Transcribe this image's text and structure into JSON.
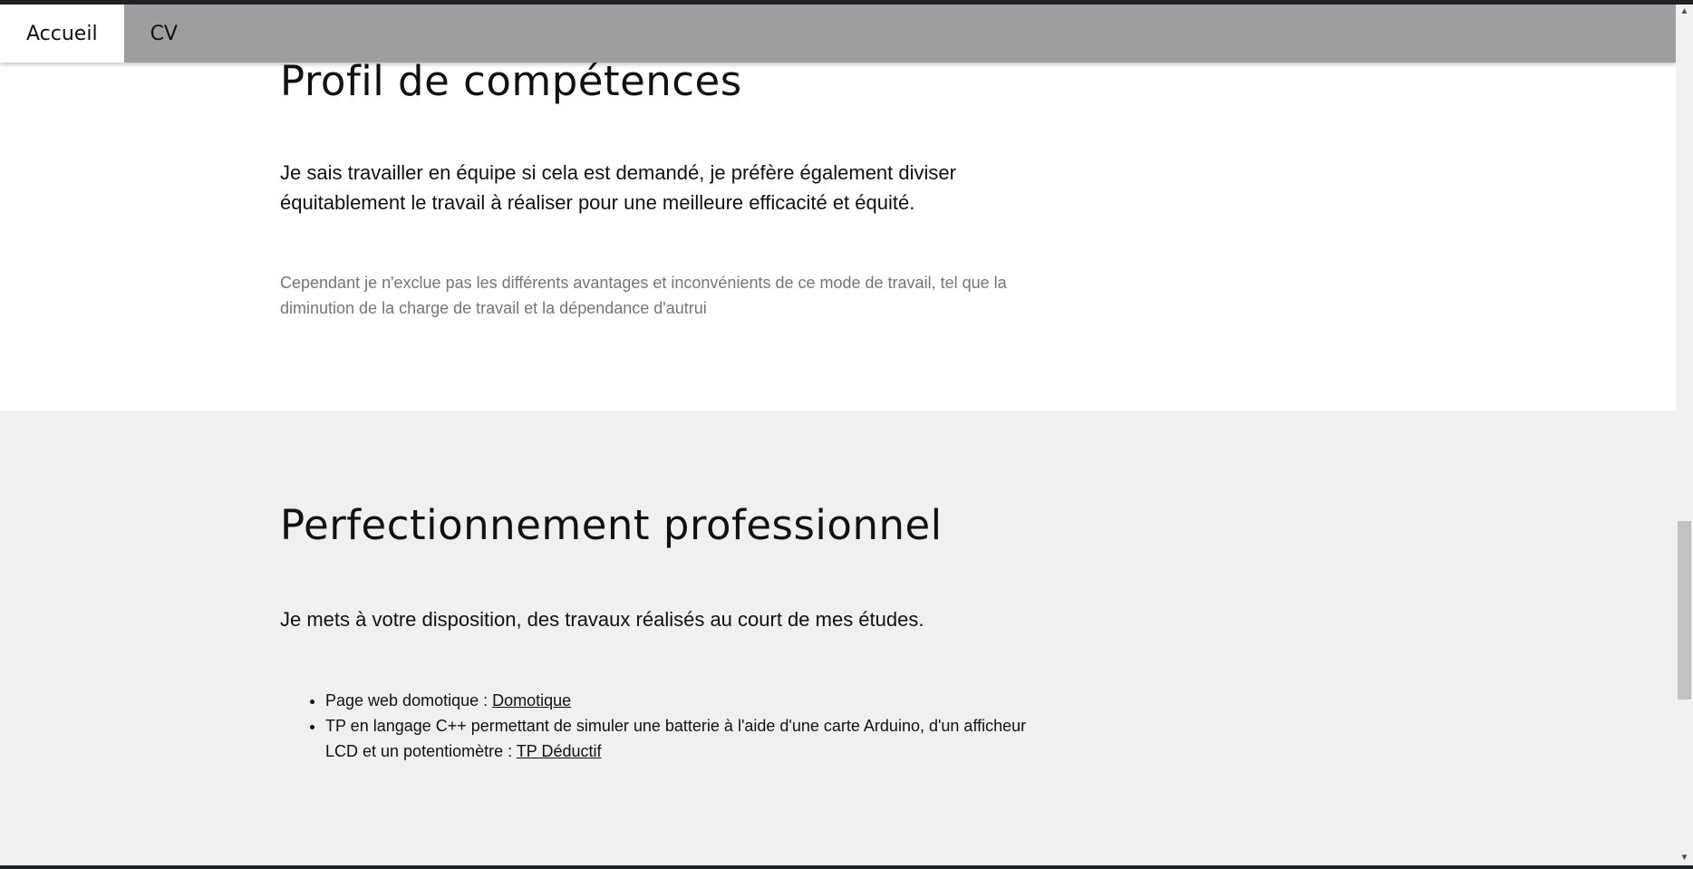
{
  "nav": {
    "items": [
      {
        "label": "Accueil",
        "active": true
      },
      {
        "label": "CV",
        "active": false
      }
    ]
  },
  "skills_section": {
    "title": "Profil de compétences",
    "lead": "Je sais travailler en équipe si cela est demandé, je préfère également diviser équitablement le travail à réaliser pour une meilleure efficacité et équité.",
    "note": "Cependant je n'exclue pas les différents avantages et inconvénients de ce mode de travail, tel que la diminution de la charge de travail et la dépendance d'autrui"
  },
  "pro_section": {
    "title": "Perfectionnement professionnel",
    "lead": "Je mets à votre disposition, des travaux réalisés au court de mes études.",
    "items": [
      {
        "text": "Page web domotique : ",
        "link": "Domotique"
      },
      {
        "text": "TP en langage C++ permettant de simuler une batterie à l'aide d'une carte Arduino, d'un afficheur LCD et un potentiomètre : ",
        "link": "TP Déductif"
      }
    ]
  },
  "scrollbar": {
    "up_icon": "triangle-up-icon",
    "down_icon": "triangle-down-icon"
  },
  "colors": {
    "nav_background": "#9e9e9e",
    "section_alt_background": "#f0f0f0",
    "muted_text": "#757575"
  }
}
